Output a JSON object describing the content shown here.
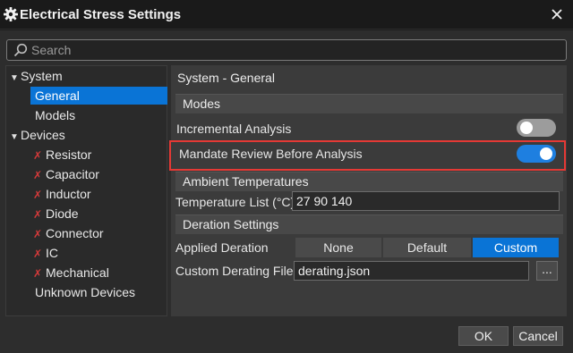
{
  "window": {
    "title": "Electrical Stress Settings"
  },
  "search": {
    "placeholder": "Search"
  },
  "tree": {
    "system": {
      "label": "System",
      "children": {
        "general": "General",
        "models": "Models"
      }
    },
    "devices": {
      "label": "Devices",
      "children": [
        "Resistor",
        "Capacitor",
        "Inductor",
        "Diode",
        "Connector",
        "IC",
        "Mechanical"
      ]
    },
    "unknown": "Unknown Devices"
  },
  "panel": {
    "heading": "System - General",
    "modes": {
      "title": "Modes",
      "incremental_label": "Incremental Analysis",
      "incremental_on": false,
      "mandate_label": "Mandate Review Before Analysis",
      "mandate_on": true
    },
    "ambient": {
      "title": "Ambient Temperatures",
      "list_label": "Temperature List (°C)",
      "list_value": "27 90 140"
    },
    "deration": {
      "title": "Deration Settings",
      "applied_label": "Applied Deration",
      "options": [
        "None",
        "Default",
        "Custom"
      ],
      "selected": "Custom",
      "file_label": "Custom Derating File",
      "file_value": "derating.json",
      "browse_label": "..."
    }
  },
  "footer": {
    "ok": "OK",
    "cancel": "Cancel"
  },
  "colors": {
    "accent": "#0a74d6",
    "highlight": "#e53935",
    "device_icon": "#d53a3a"
  }
}
